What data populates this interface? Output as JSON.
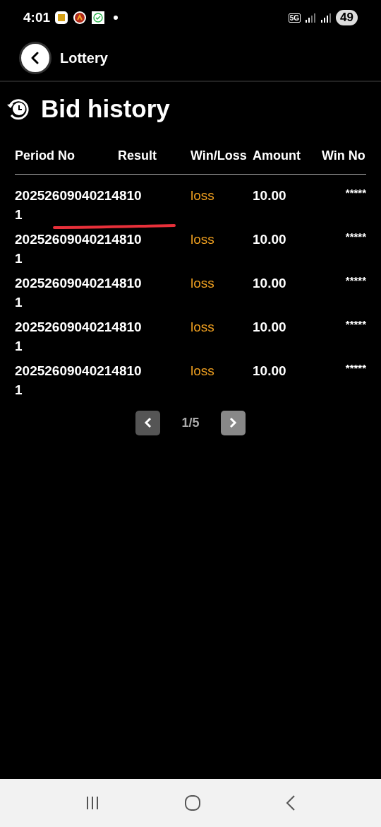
{
  "status_bar": {
    "time": "4:01",
    "network": "5G",
    "battery": "49"
  },
  "header": {
    "title": "Lottery"
  },
  "page_title": "Bid history",
  "columns": [
    "Period No",
    "Result",
    "Win/Loss",
    "Amount",
    "Win No"
  ],
  "rows": [
    {
      "period": "202526090402148101",
      "win_loss": "loss",
      "amount": "10.00",
      "win_no": "*****"
    },
    {
      "period": "202526090402148101",
      "win_loss": "loss",
      "amount": "10.00",
      "win_no": "*****"
    },
    {
      "period": "202526090402148101",
      "win_loss": "loss",
      "amount": "10.00",
      "win_no": "*****"
    },
    {
      "period": "202526090402148101",
      "win_loss": "loss",
      "amount": "10.00",
      "win_no": "*****"
    },
    {
      "period": "202526090402148101",
      "win_loss": "loss",
      "amount": "10.00",
      "win_no": "*****"
    }
  ],
  "pagination": {
    "prev_disabled": true,
    "page": "1/5",
    "next_disabled": false
  }
}
